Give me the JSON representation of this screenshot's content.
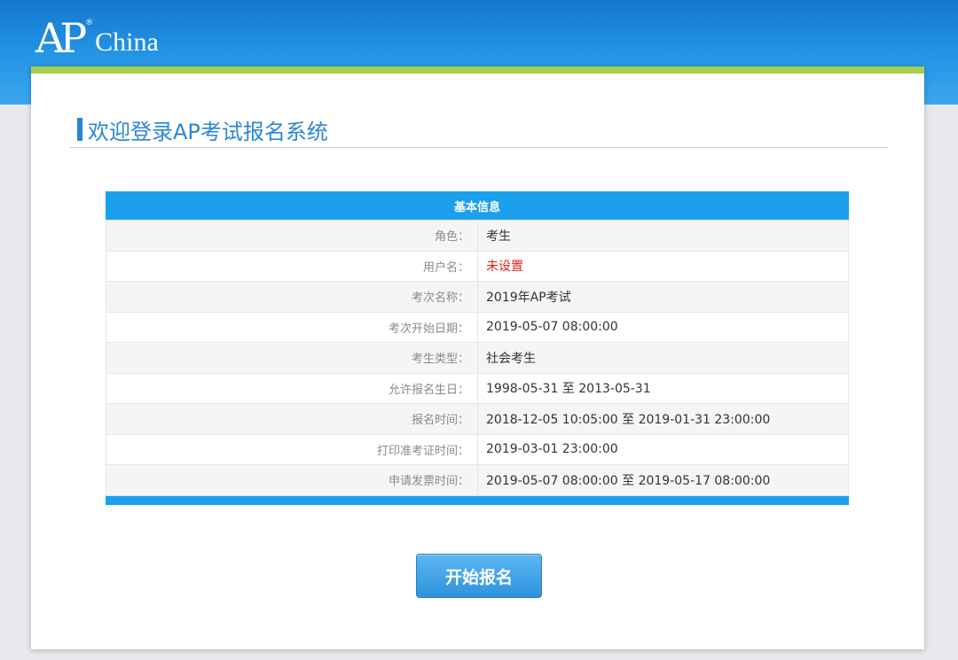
{
  "header": {
    "logo_ap": "AP",
    "logo_reg": "®",
    "logo_china": "China"
  },
  "page": {
    "title": "欢迎登录AP考试报名系统"
  },
  "info_table": {
    "heading": "基本信息",
    "rows": [
      {
        "label": "角色：",
        "value": "考生"
      },
      {
        "label": "用户名：",
        "value": "未设置",
        "value_color": "#e02020"
      },
      {
        "label": "考次名称：",
        "value": "2019年AP考试"
      },
      {
        "label": "考次开始日期：",
        "value": "2019-05-07 08:00:00"
      },
      {
        "label": "考生类型：",
        "value": "社会考生"
      },
      {
        "label": "允许报名生日：",
        "value": "1998-05-31 至 2013-05-31"
      },
      {
        "label": "报名时间：",
        "value": "2018-12-05 10:05:00 至 2019-01-31 23:00:00"
      },
      {
        "label": "打印准考证时间：",
        "value": "2019-03-01 23:00:00"
      },
      {
        "label": "申请发票时间：",
        "value": "2019-05-07 08:00:00 至 2019-05-17 08:00:00"
      }
    ]
  },
  "actions": {
    "start_label": "开始报名"
  },
  "colors": {
    "header_blue": "#2596e6",
    "accent_green": "#a6cf4e",
    "table_blue": "#1aa0ec",
    "title_blue": "#2a86d4",
    "warning_red": "#e02020"
  }
}
